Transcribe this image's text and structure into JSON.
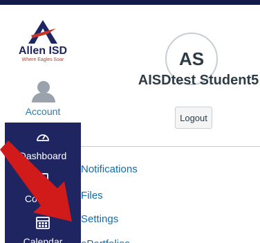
{
  "nav": {
    "logo": {
      "name": "Allen ISD",
      "tagline": "Where Eagles Soar"
    },
    "account": {
      "label": "Account",
      "icon": "user-avatar-icon"
    },
    "items": [
      {
        "label": "Dashboard",
        "icon": "speedometer-icon"
      },
      {
        "label": "Courses",
        "icon": "book-icon"
      },
      {
        "label": "Calendar",
        "icon": "calendar-icon"
      }
    ]
  },
  "profile": {
    "initials": "AS",
    "name": "AISDtest Student5",
    "logout_label": "Logout",
    "links": [
      {
        "label": "Notifications"
      },
      {
        "label": "Files"
      },
      {
        "label": "Settings"
      },
      {
        "label": "ePortfolios"
      }
    ]
  },
  "colors": {
    "nav_background": "#1e2560",
    "link": "#0e6dae",
    "annotation_arrow": "#d11a1a"
  }
}
